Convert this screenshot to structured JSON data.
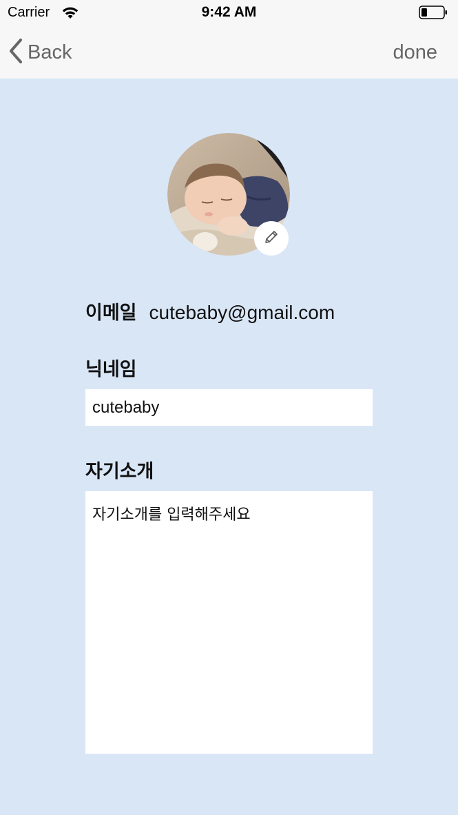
{
  "status_bar": {
    "carrier": "Carrier",
    "time": "9:42 AM",
    "icons": [
      "wifi-icon",
      "battery-icon"
    ]
  },
  "nav": {
    "back_label": "Back",
    "done_label": "done",
    "back_icon": "chevron-left-icon"
  },
  "profile": {
    "avatar_description": "sleeping-baby-photo",
    "edit_icon": "pencil-icon",
    "email_label": "이메일",
    "email_value": "cutebaby@gmail.com",
    "nickname_label": "닉네임",
    "nickname_value": "cutebaby",
    "bio_label": "자기소개",
    "bio_placeholder": "자기소개를 입력해주세요"
  },
  "colors": {
    "background": "#d9e6f6",
    "bar": "#f7f7f7",
    "nav_text": "#666666",
    "field_bg": "#ffffff"
  }
}
